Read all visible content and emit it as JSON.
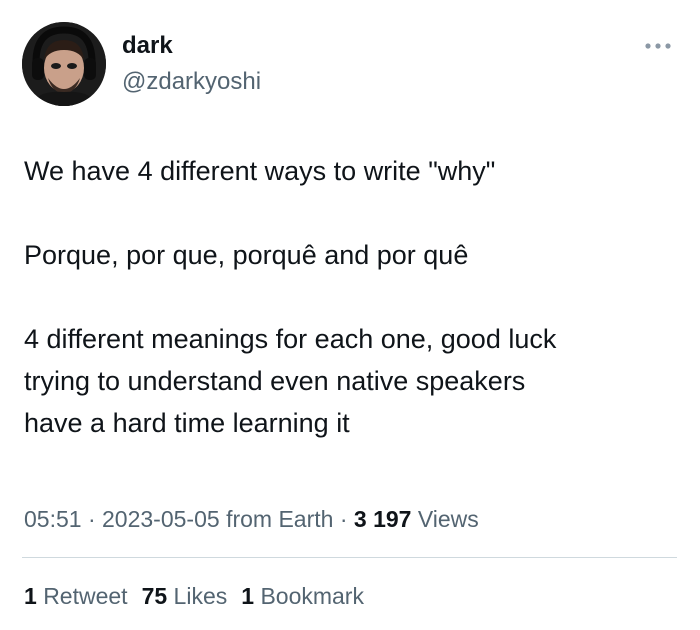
{
  "author": {
    "name": "dark",
    "handle": "@zdarkyoshi"
  },
  "more_icon": "more-horizontal-icon",
  "tweet": {
    "paragraph_1": "We have 4 different ways to write \"why\"",
    "paragraph_2": "Porque, por que, porquê and por quê",
    "paragraph_3_line_1": "4 different meanings for each one, good luck",
    "paragraph_3_line_2": "trying to understand even native speakers",
    "paragraph_3_line_3": "have a hard time learning it"
  },
  "meta": {
    "time": "05:51",
    "separator": "·",
    "date": "2023-05-05",
    "source": "from Earth",
    "views_count": "3 197",
    "views_label": "Views"
  },
  "stats": {
    "retweets_count": "1",
    "retweets_label": "Retweet",
    "likes_count": "75",
    "likes_label": "Likes",
    "bookmarks_count": "1",
    "bookmarks_label": "Bookmark"
  },
  "colors": {
    "text_primary": "#0f1419",
    "text_secondary": "#536471",
    "divider": "#cfd9de"
  }
}
